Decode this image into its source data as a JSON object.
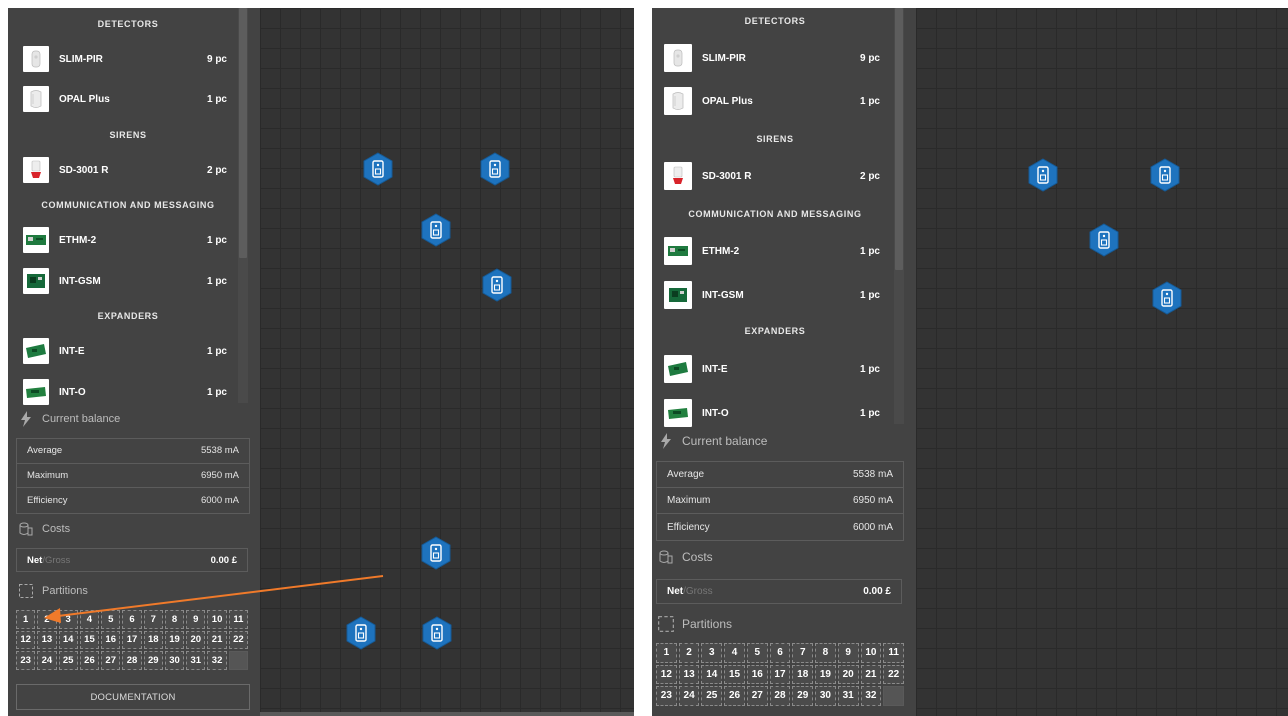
{
  "sections": {
    "detectors": "DETECTORS",
    "sirens": "SIRENS",
    "communication": "COMMUNICATION AND MESSAGING",
    "expanders": "EXPANDERS"
  },
  "devices": {
    "slim_pir": {
      "name": "SLIM-PIR",
      "qty": "9 pc",
      "icon": "motion-detector-icon"
    },
    "opal_plus": {
      "name": "OPAL Plus",
      "qty": "1 pc",
      "icon": "outdoor-detector-icon"
    },
    "sd_3001_r": {
      "name": "SD-3001 R",
      "qty": "2 pc",
      "icon": "siren-icon"
    },
    "ethm_2": {
      "name": "ETHM-2",
      "qty": "1 pc",
      "icon": "module-board-icon"
    },
    "int_gsm": {
      "name": "INT-GSM",
      "qty": "1 pc",
      "icon": "gsm-board-icon"
    },
    "int_e": {
      "name": "INT-E",
      "qty": "1 pc",
      "icon": "expander-board-icon"
    },
    "int_o": {
      "name": "INT-O",
      "qty": "1 pc",
      "icon": "expander-board-icon"
    }
  },
  "balance": {
    "title": "Current balance",
    "icon": "lightning-icon",
    "rows": [
      {
        "label": "Average",
        "value": "5538 mA"
      },
      {
        "label": "Maximum",
        "value": "6950 mA"
      },
      {
        "label": "Efficiency",
        "value": "6000 mA"
      }
    ]
  },
  "costs": {
    "title": "Costs",
    "icon": "coins-icon",
    "net_label": "Net",
    "gross_label": "/Gross",
    "value": "0.00 £"
  },
  "partitions": {
    "title": "Partitions",
    "icon": "dashed-square-icon",
    "numbers": [
      "1",
      "2",
      "3",
      "4",
      "5",
      "6",
      "7",
      "8",
      "9",
      "10",
      "11",
      "12",
      "13",
      "14",
      "15",
      "16",
      "17",
      "18",
      "19",
      "20",
      "21",
      "22",
      "23",
      "24",
      "25",
      "26",
      "27",
      "28",
      "29",
      "30",
      "31",
      "32"
    ]
  },
  "documentation_label": "DOCUMENTATION",
  "colors": {
    "sidebar_bg": "#434343",
    "canvas_bg": "#333333",
    "marker_blue": "#1e73be",
    "arrow_orange": "#f07a2a"
  },
  "canvas_marker_icon": "device-location-marker-icon"
}
